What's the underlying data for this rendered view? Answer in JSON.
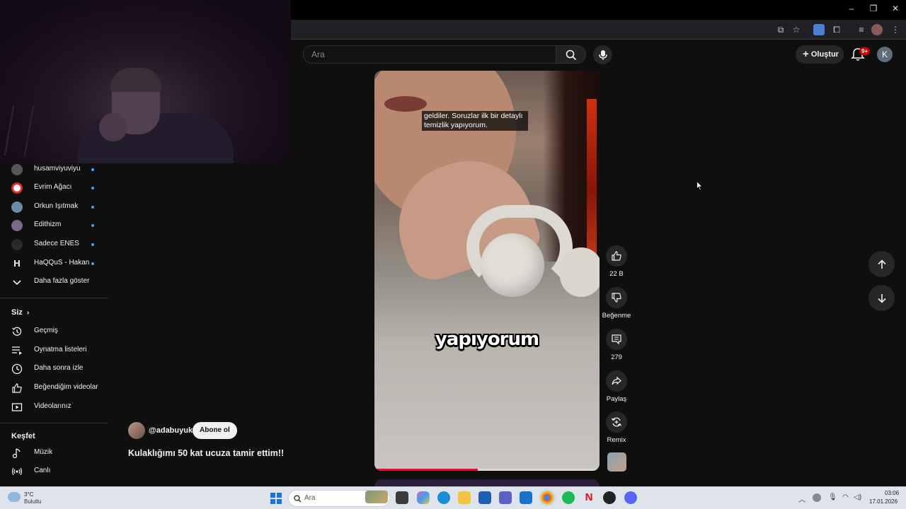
{
  "header": {
    "search_placeholder": "Ara",
    "create_label": "Oluştur",
    "notification_badge": "9+",
    "avatar_letter": "K"
  },
  "sidebar": {
    "subscriptions": [
      {
        "label": "husamviyuviyu"
      },
      {
        "label": "Evrim Ağacı"
      },
      {
        "label": "Orkun Işıtmak"
      },
      {
        "label": "Edithizm"
      },
      {
        "label": "Sadece ENES"
      },
      {
        "label": "HaQQuS - Hakan..."
      }
    ],
    "show_more": "Daha fazla göster",
    "you_section": "Siz",
    "you_items": [
      {
        "label": "Geçmiş",
        "icon": "history-icon"
      },
      {
        "label": "Oynatma listeleri",
        "icon": "playlists-icon"
      },
      {
        "label": "Daha sonra izle",
        "icon": "watch-later-icon"
      },
      {
        "label": "Beğendiğim videolar",
        "icon": "liked-icon"
      },
      {
        "label": "Videolarınız",
        "icon": "your-videos-icon"
      }
    ],
    "explore_section": "Keşfet",
    "explore_items": [
      {
        "label": "Müzik",
        "icon": "music-icon"
      },
      {
        "label": "Canlı",
        "icon": "live-icon"
      }
    ]
  },
  "short": {
    "caption_top": "geldiler. Soruzlar ilk bir detaylı temizlik yapıyorum.",
    "caption_big": "yapıyorum",
    "progress": 0.46,
    "channel": "@adabuyuk",
    "subscribe_label": "Abone ol",
    "title": "Kulaklığımı 50 kat ucuza tamir ettim!!"
  },
  "actions": {
    "likes": "22 B",
    "dislike_label": "Beğenme",
    "comments": "279",
    "share_label": "Paylaş",
    "remix_label": "Remix"
  },
  "taskbar": {
    "weather_temp": "3°C",
    "weather_desc": "Bulutlu",
    "search_label": "Ara",
    "time": "03:06",
    "date": "17.01.2026"
  }
}
